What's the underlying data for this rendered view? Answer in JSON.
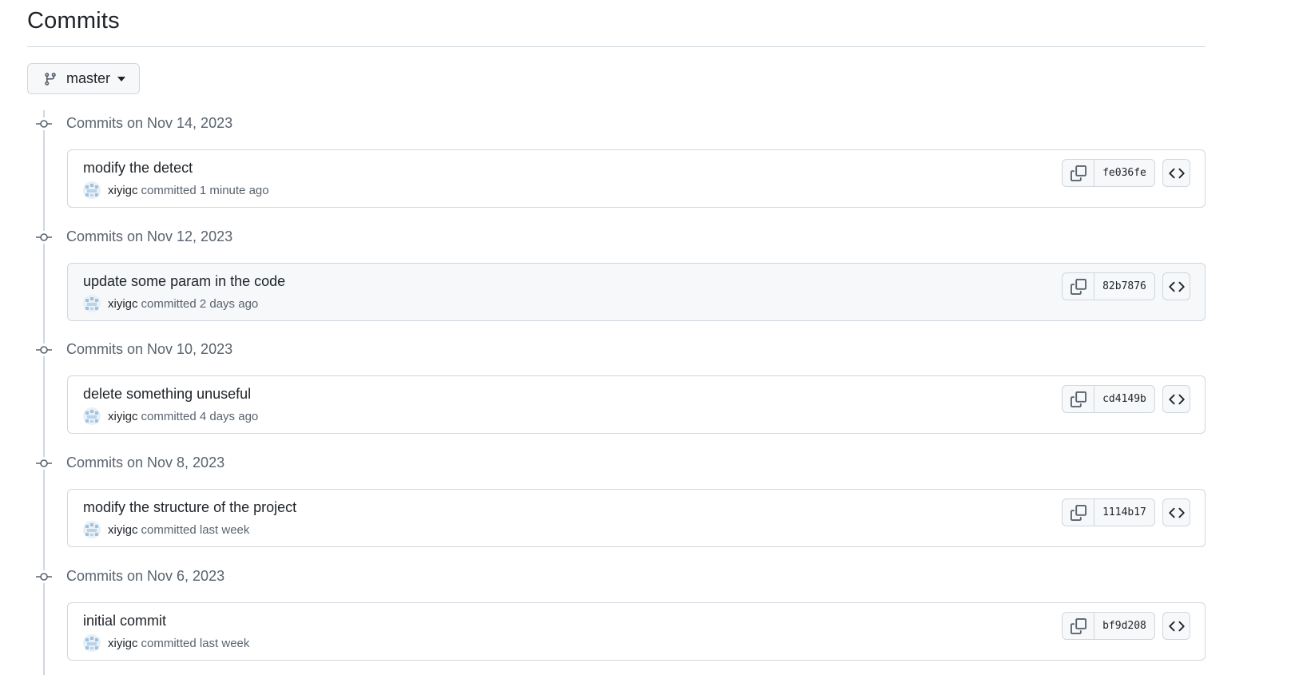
{
  "header": {
    "title": "Commits"
  },
  "branch_selector": {
    "label": "master",
    "icon": "git-branch-icon"
  },
  "groups": [
    {
      "date_label": "Commits on Nov 14, 2023",
      "commit": {
        "message": "modify the detect",
        "author": "xiyigc",
        "time": "committed 1 minute ago",
        "sha": "fe036fe"
      }
    },
    {
      "date_label": "Commits on Nov 12, 2023",
      "commit": {
        "message": "update some param in the code",
        "author": "xiyigc",
        "time": "committed 2 days ago",
        "sha": "82b7876"
      }
    },
    {
      "date_label": "Commits on Nov 10, 2023",
      "commit": {
        "message": "delete something unuseful",
        "author": "xiyigc",
        "time": "committed 4 days ago",
        "sha": "cd4149b"
      }
    },
    {
      "date_label": "Commits on Nov 8, 2023",
      "commit": {
        "message": "modify the structure of the project",
        "author": "xiyigc",
        "time": "committed last week",
        "sha": "1114b17"
      }
    },
    {
      "date_label": "Commits on Nov 6, 2023",
      "commit": {
        "message": "initial commit",
        "author": "xiyigc",
        "time": "committed last week",
        "sha": "bf9d208"
      }
    }
  ],
  "colors": {
    "border": "#d0d7de",
    "muted_text": "#59636e",
    "text": "#1f2328",
    "button_bg": "#f6f8fa"
  }
}
